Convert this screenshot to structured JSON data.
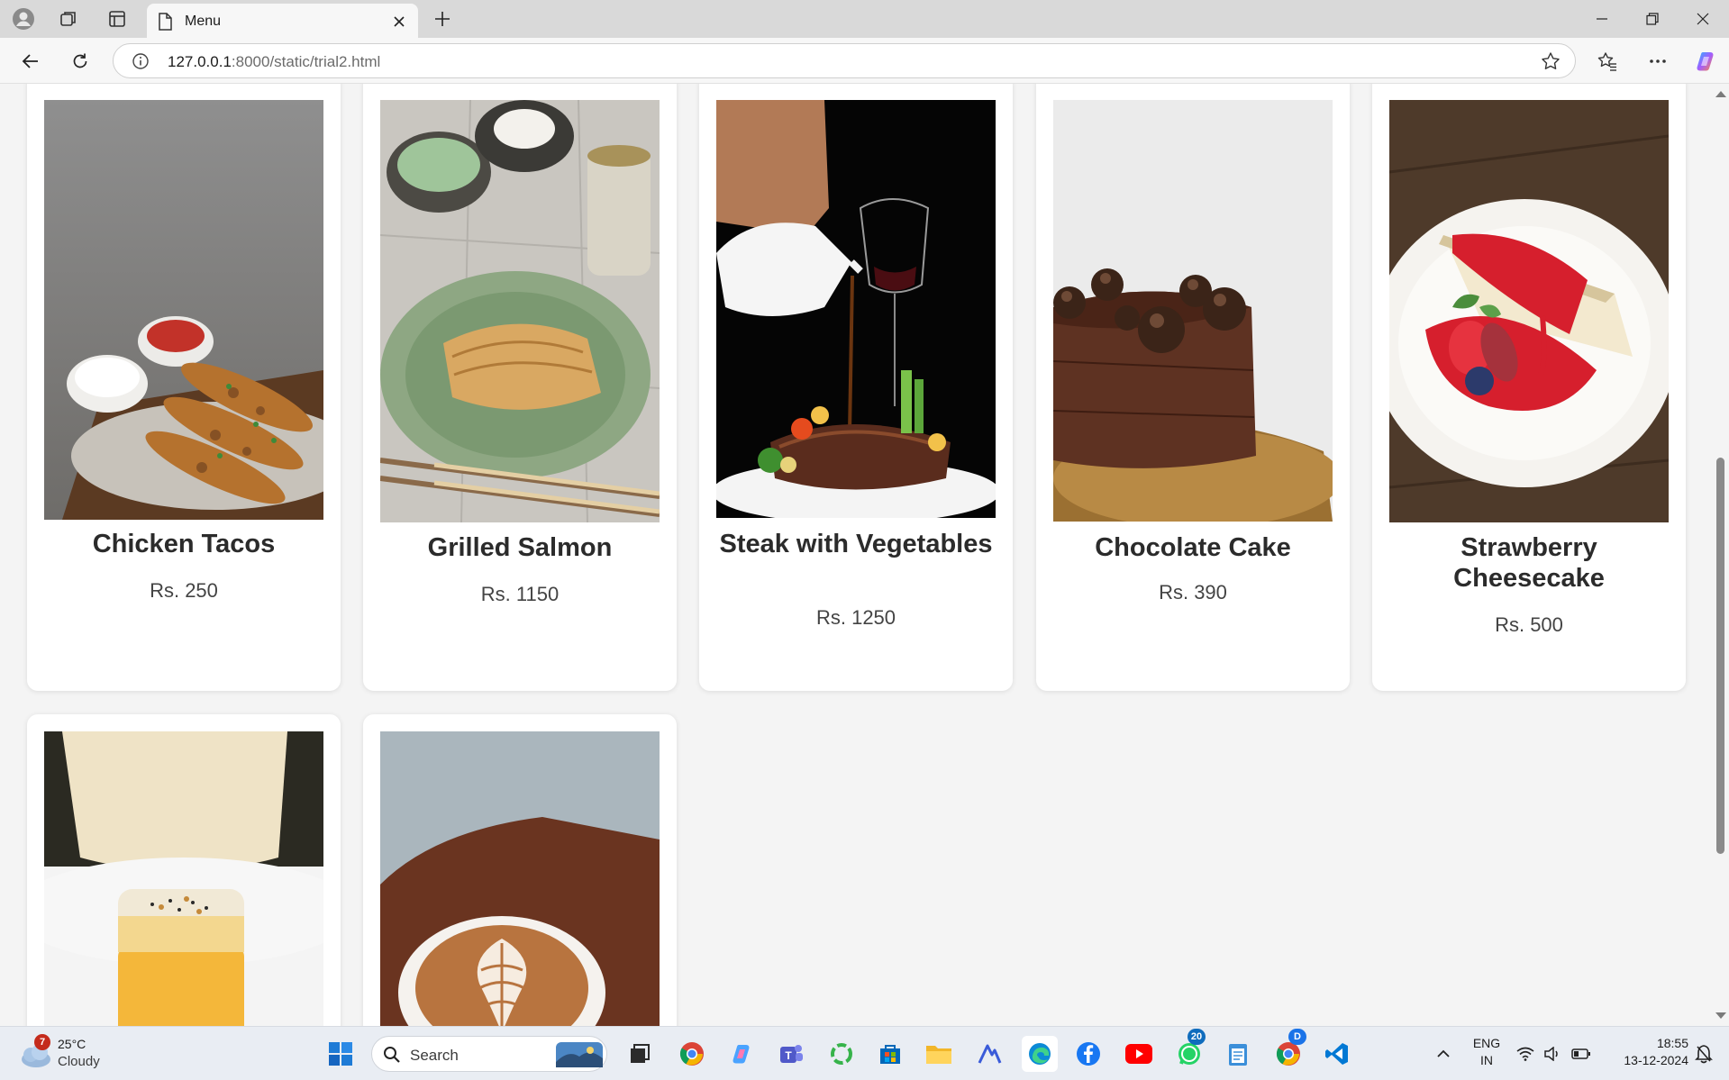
{
  "browser": {
    "tab_title": "Menu",
    "url_host": "127.0.0.1",
    "url_rest": ":8000/static/trial2.html"
  },
  "menu": {
    "items": [
      {
        "name": "Chicken Tacos",
        "price": "Rs. 250"
      },
      {
        "name": "Grilled Salmon",
        "price": "Rs. 1150"
      },
      {
        "name": "Steak with Vegetables",
        "price": "Rs. 1250"
      },
      {
        "name": "Chocolate Cake",
        "price": "Rs. 390"
      },
      {
        "name": "Strawberry Cheesecake",
        "price": "Rs. 500"
      }
    ]
  },
  "taskbar": {
    "weather_temp": "25°C",
    "weather_condition": "Cloudy",
    "weather_badge": "7",
    "search_label": "Search",
    "whatsapp_badge": "20",
    "chrome_badge": "D",
    "lang_line1": "ENG",
    "lang_line2": "IN",
    "time": "18:55",
    "date": "13-12-2024"
  }
}
